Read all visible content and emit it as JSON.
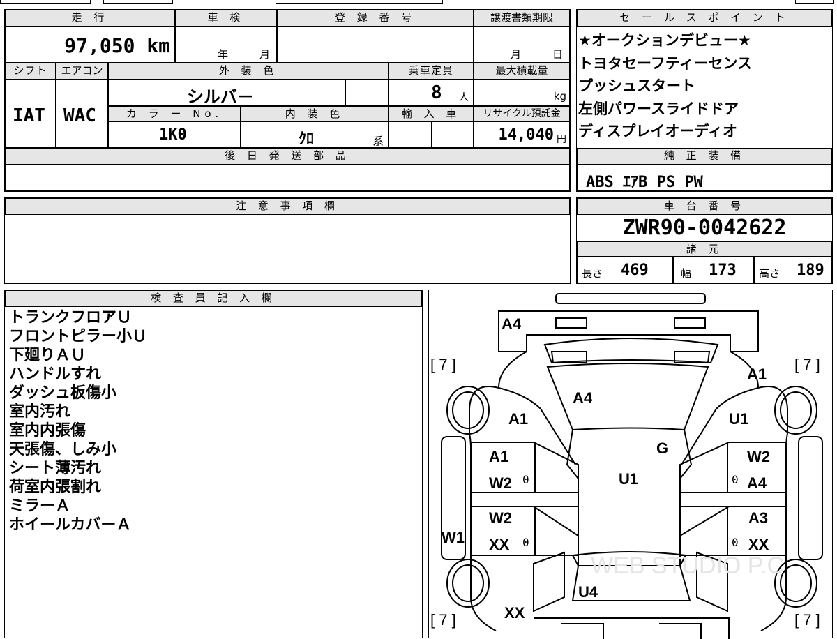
{
  "top_info": {
    "mileage_header": "走 行",
    "mileage_value": "97,050 km",
    "shaken_header": "車 検",
    "shaken_year": "年",
    "shaken_month": "月",
    "reg_header": "登 録 番 号",
    "transfer_header": "譲渡書類期限",
    "transfer_month": "月",
    "transfer_day": "日",
    "shift_header": "シフト",
    "aircon_header": "エアコン",
    "exterior_header": "外 装 色",
    "capacity_header": "乗車定員",
    "maxload_header": "最大積載量",
    "shift_value": "IAT",
    "aircon_value": "WAC",
    "exterior_value": "シルバ－",
    "capacity_value": "8",
    "capacity_unit": "人",
    "maxload_unit": "kg",
    "colorno_header": "カ ラ ー No.",
    "interior_header": "内 装 色",
    "import_header": "輸 入 車",
    "recycle_header": "リサイクル預託金",
    "colorno_value": "1K0",
    "interior_value": "ｸﾛ",
    "interior_suffix": "系",
    "recycle_value": "14,040",
    "recycle_unit": "円",
    "later_parts_header": "後 日 発 送 部 品"
  },
  "sales_points": {
    "header": "セ ー ル ス ポ イ ン ト",
    "items": [
      "★オークションデビュー★",
      "トヨタセーフティーセンス",
      "プッシュスタート",
      "左側パワースライドドア",
      "ディスプレイオーディオ"
    ]
  },
  "genuine_equipment": {
    "header": "純 正 装 備",
    "value": "ABS ｴｱB PS PW"
  },
  "caution": {
    "header": "注 意 事 項 欄"
  },
  "chassis": {
    "header": "車 台 番 号",
    "value": "ZWR90-0042622"
  },
  "specs": {
    "header": "諸 元",
    "length_label": "長さ",
    "length_value": "469",
    "width_label": "幅",
    "width_value": "173",
    "height_label": "高さ",
    "height_value": "189"
  },
  "inspector": {
    "header": "検 査 員 記 入 欄",
    "notes": [
      "トランクフロアＵ",
      "フロントピラー小Ｕ",
      "下廻りＡＵ",
      "ハンドルすれ",
      "ダッシュ板傷小",
      "室内汚れ",
      "室内内張傷",
      "天張傷、しみ小",
      "シート薄汚れ",
      "荷室内張割れ",
      "ミラーＡ",
      "ホイールカバーＡ"
    ]
  },
  "diagram": {
    "tire_tl": "[ 7 ]",
    "tire_tr": "[ 7 ]",
    "tire_bl": "[ 7 ]",
    "tire_br": "[ 7 ]",
    "rear": "A4",
    "back_glass": "A4",
    "left_quarter": "A1",
    "right_quarter_a": "A1",
    "right_quarter_u": "U1",
    "roof_g": "G",
    "roof_u": "U1",
    "left_rear_door_a": "A1",
    "left_rear_door_w": "W2",
    "left_rear_door_0": "0",
    "right_rear_door_w": "W2",
    "right_rear_door_a": "A4",
    "right_rear_door_0": "0",
    "left_front_door_w": "W2",
    "left_front_door_x": "XX",
    "left_front_door_0": "0",
    "right_front_door_a": "A3",
    "right_front_door_x": "XX",
    "right_front_door_0": "0",
    "left_step": "W1",
    "hood": "U4",
    "front_left": "XX",
    "watermark": "WEB STUDIO P.C"
  }
}
